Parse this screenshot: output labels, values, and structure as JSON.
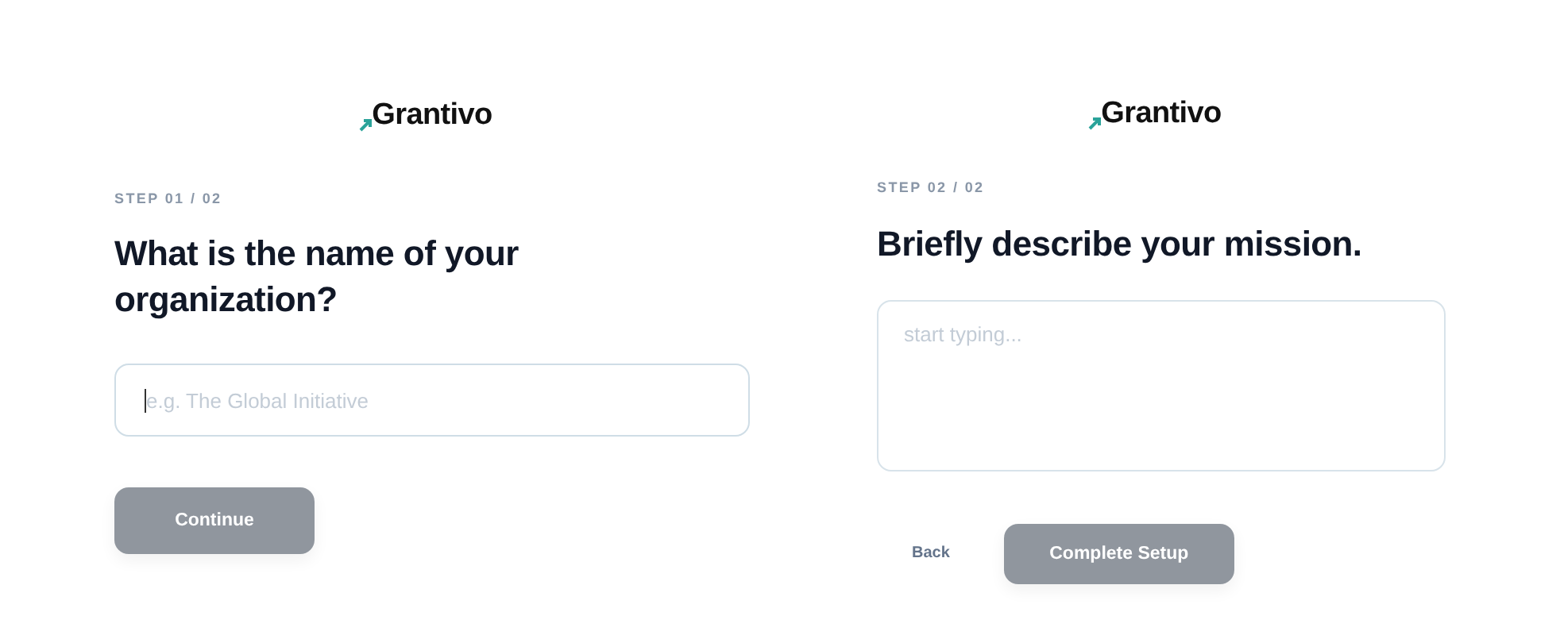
{
  "panels": [
    {
      "logo": "Grantivo",
      "step": "STEP 01 / 02",
      "heading": "What is the name of your organization?",
      "field": {
        "kind": "input",
        "placeholder": "e.g. The Global Initiative",
        "focused": true
      },
      "buttons": [
        {
          "kind": "primary",
          "label": "Continue",
          "disabled": true
        }
      ]
    },
    {
      "logo": "Grantivo",
      "step": "STEP 02 / 02",
      "heading": "Briefly describe your mission.",
      "field": {
        "kind": "textarea",
        "placeholder": "start typing...",
        "focused": false
      },
      "buttons": [
        {
          "kind": "link",
          "label": "Back",
          "disabled": false
        },
        {
          "kind": "primary",
          "label": "Complete Setup",
          "disabled": true
        }
      ]
    }
  ]
}
